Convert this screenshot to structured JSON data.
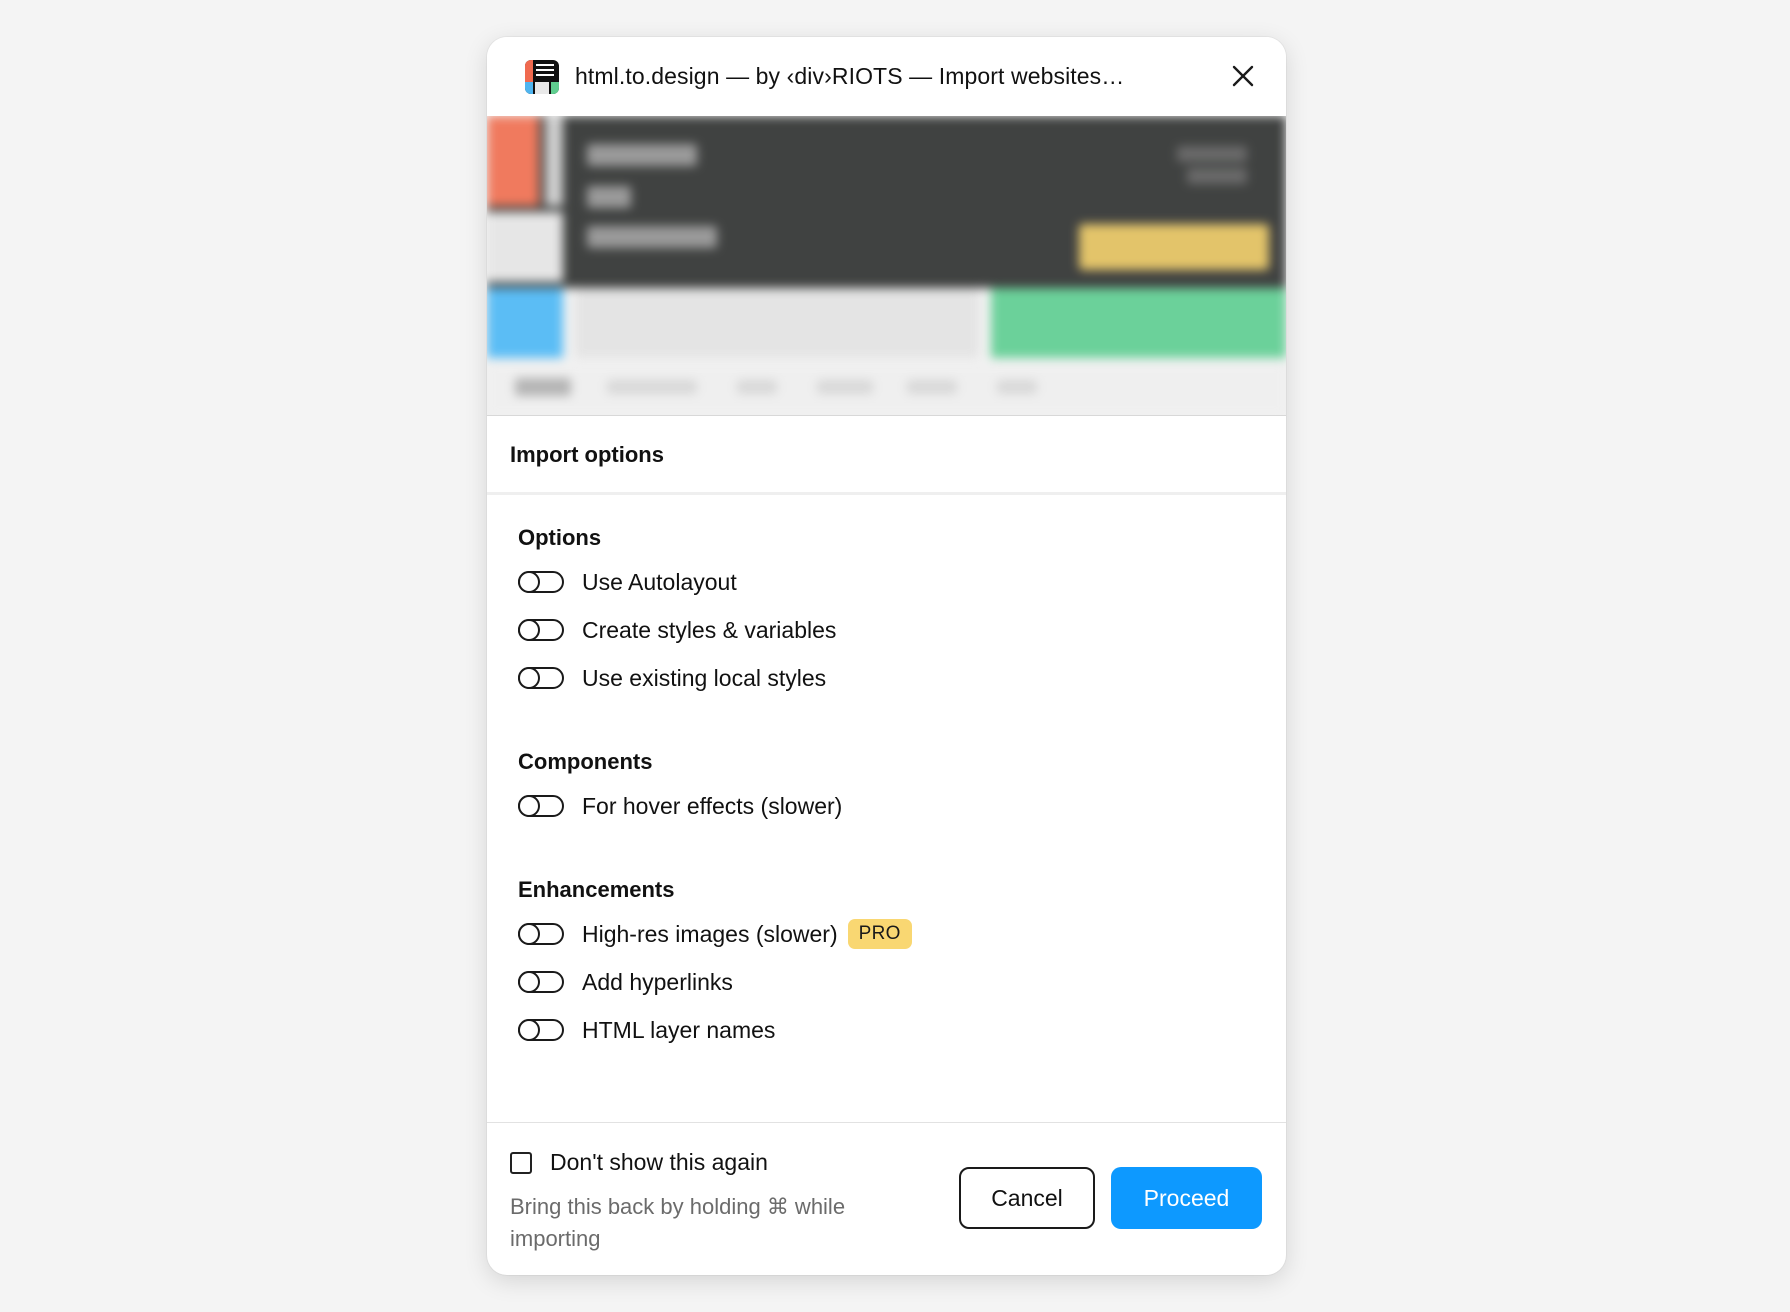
{
  "dialog": {
    "title": "html.to.design — by ‹div›RIOTS — Import websites…",
    "close_icon": "close-icon",
    "app_icon": "html-to-design-logo"
  },
  "import_options": {
    "heading": "Import options",
    "groups": [
      {
        "title": "Options",
        "items": [
          {
            "label": "Use Autolayout",
            "on": false
          },
          {
            "label": "Create styles & variables",
            "on": false
          },
          {
            "label": "Use existing local styles",
            "on": false
          }
        ]
      },
      {
        "title": "Components",
        "items": [
          {
            "label": "For hover effects (slower)",
            "on": false
          }
        ]
      },
      {
        "title": "Enhancements",
        "items": [
          {
            "label": "High-res images (slower)",
            "on": false,
            "badge": "PRO"
          },
          {
            "label": "Add hyperlinks",
            "on": false
          },
          {
            "label": "HTML layer names",
            "on": false
          }
        ]
      }
    ]
  },
  "footer": {
    "dont_show_label": "Don't show this again",
    "dont_show_checked": false,
    "hint": "Bring this back by holding ⌘ while importing",
    "cancel_label": "Cancel",
    "proceed_label": "Proceed"
  },
  "colors": {
    "accent": "#0d99ff",
    "pro_badge": "#f9d772",
    "preview_dark": "#404241",
    "preview_orange": "#f07a5e",
    "preview_blue": "#5bbdf5",
    "preview_green": "#6bd19a"
  }
}
